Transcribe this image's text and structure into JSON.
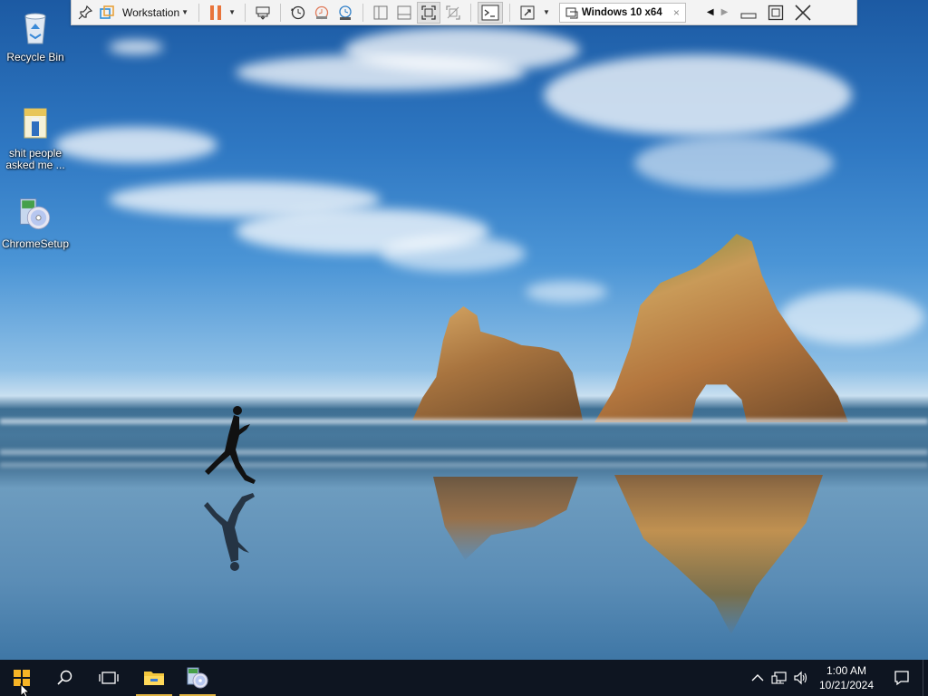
{
  "vm_toolbar": {
    "vm_menu_label": "Workstation",
    "tab_title": "Windows 10 x64",
    "tab_close": "×"
  },
  "desktop": {
    "icons": [
      {
        "label": "Recycle Bin",
        "icon": "recycle-bin-icon"
      },
      {
        "label": "shit people asked me ...",
        "icon": "text-file-icon"
      },
      {
        "label": "ChromeSetup",
        "icon": "setup-disc-icon"
      }
    ]
  },
  "taskbar": {
    "items": [
      "start-button",
      "search-button",
      "task-view-button",
      "file-explorer",
      "recycle-setup-app"
    ],
    "clock_time": "1:00 AM",
    "clock_date": "10/21/2024"
  },
  "colors": {
    "taskbar_bg": "#0e1521",
    "active_indicator": "#e0b341",
    "pause_orange": "#e8743b",
    "windows_logo": "#f6b426"
  }
}
